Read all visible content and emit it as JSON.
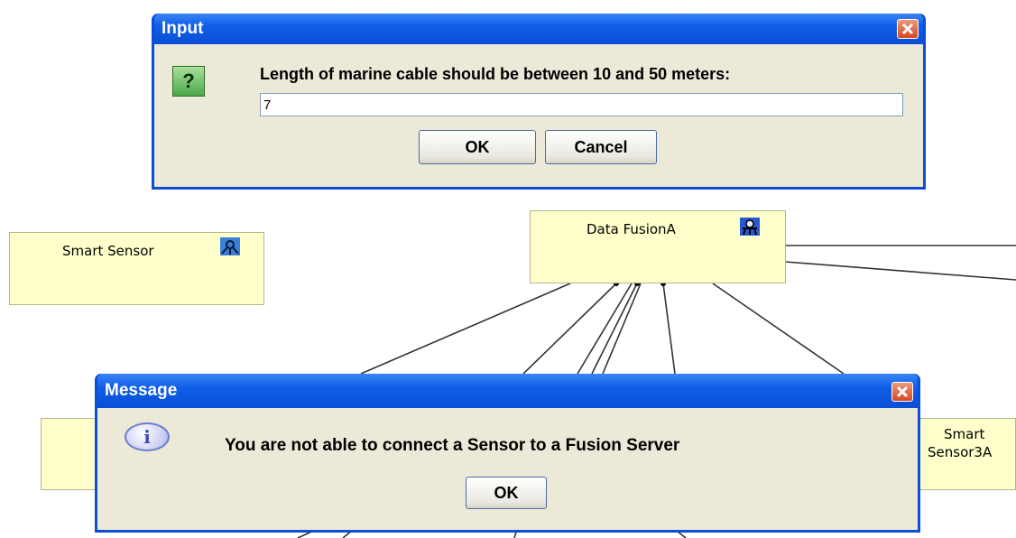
{
  "input_dialog": {
    "title": "Input",
    "prompt": "Length of marine cable should be between 10 and 50 meters:",
    "value": "7",
    "ok_label": "OK",
    "cancel_label": "Cancel",
    "icon": "question-icon"
  },
  "message_dialog": {
    "title": "Message",
    "text": "You are not able to connect a Sensor to a Fusion Server",
    "ok_label": "OK",
    "icon": "info-icon"
  },
  "diagram": {
    "nodes": [
      {
        "label": "Smart Sensor",
        "icon": "sensor-icon"
      },
      {
        "label": "Data FusionA",
        "icon": "fusion-server-icon"
      },
      {
        "label_line1": "Smart",
        "label_line2": "Sensor3A"
      }
    ]
  },
  "colors": {
    "title_bar": "#0a4fd6",
    "dialog_body": "#ece9d8",
    "node_fill": "#ffffcc",
    "close_button": "#d6451f"
  }
}
